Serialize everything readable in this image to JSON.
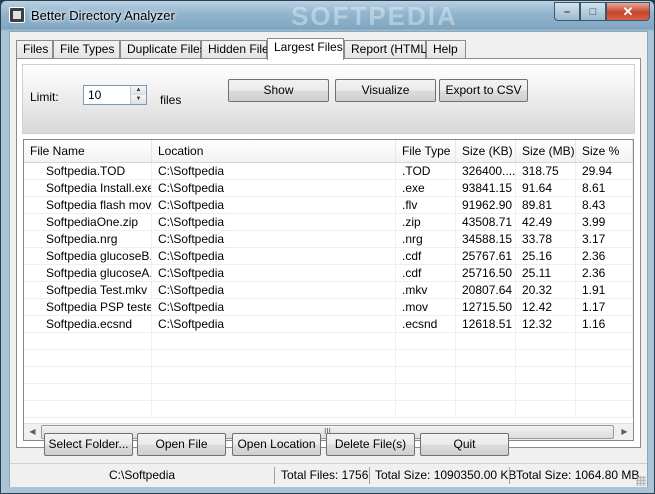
{
  "window": {
    "title": "Better Directory Analyzer",
    "watermark": "SOFTPEDIA",
    "minimize": "–",
    "maximize": "□",
    "close": "✕"
  },
  "tabs": [
    {
      "label": "Files"
    },
    {
      "label": "File Types"
    },
    {
      "label": "Duplicate Files"
    },
    {
      "label": "Hidden Files"
    },
    {
      "label": "Largest Files",
      "active": true
    },
    {
      "label": "Report (HTML)"
    },
    {
      "label": "Help"
    }
  ],
  "controls": {
    "limit_label": "Limit:",
    "limit_value": "10",
    "files_label": "files",
    "show_button": "Show",
    "visualize_button": "Visualize",
    "export_button": "Export to CSV"
  },
  "table": {
    "columns": [
      "File Name",
      "Location",
      "File Type",
      "Size (KB)",
      "Size (MB)",
      "Size %"
    ],
    "rows": [
      [
        "Softpedia.TOD",
        "C:\\Softpedia",
        ".TOD",
        "326400....",
        "318.75",
        "29.94"
      ],
      [
        "Softpedia Install.exe",
        "C:\\Softpedia",
        ".exe",
        "93841.15",
        "91.64",
        "8.61"
      ],
      [
        "Softpedia flash movi...",
        "C:\\Softpedia",
        ".flv",
        "91962.90",
        "89.81",
        "8.43"
      ],
      [
        "SoftpediaOne.zip",
        "C:\\Softpedia",
        ".zip",
        "43508.71",
        "42.49",
        "3.99"
      ],
      [
        "Softpedia.nrg",
        "C:\\Softpedia",
        ".nrg",
        "34588.15",
        "33.78",
        "3.17"
      ],
      [
        "Softpedia glucoseB....",
        "C:\\Softpedia",
        ".cdf",
        "25767.61",
        "25.16",
        "2.36"
      ],
      [
        "Softpedia glucoseA....",
        "C:\\Softpedia",
        ".cdf",
        "25716.50",
        "25.11",
        "2.36"
      ],
      [
        "Softpedia Test.mkv",
        "C:\\Softpedia",
        ".mkv",
        "20807.64",
        "20.32",
        "1.91"
      ],
      [
        "Softpedia PSP teste...",
        "C:\\Softpedia",
        ".mov",
        "12715.50",
        "12.42",
        "1.17"
      ],
      [
        "Softpedia.ecsnd",
        "C:\\Softpedia",
        ".ecsnd",
        "12618.51",
        "12.32",
        "1.16"
      ]
    ],
    "scroll_thumb_grip": "III"
  },
  "actions": {
    "select_folder": "Select Folder...",
    "open_file": "Open File",
    "open_location": "Open Location",
    "delete_files": "Delete File(s)",
    "quit": "Quit"
  },
  "status": {
    "path": "C:\\Softpedia",
    "total_files": "Total Files: 1756",
    "total_size_kb": "Total Size: 1090350.00 KB",
    "total_size_mb": "Total Size: 1064.80 MB"
  }
}
